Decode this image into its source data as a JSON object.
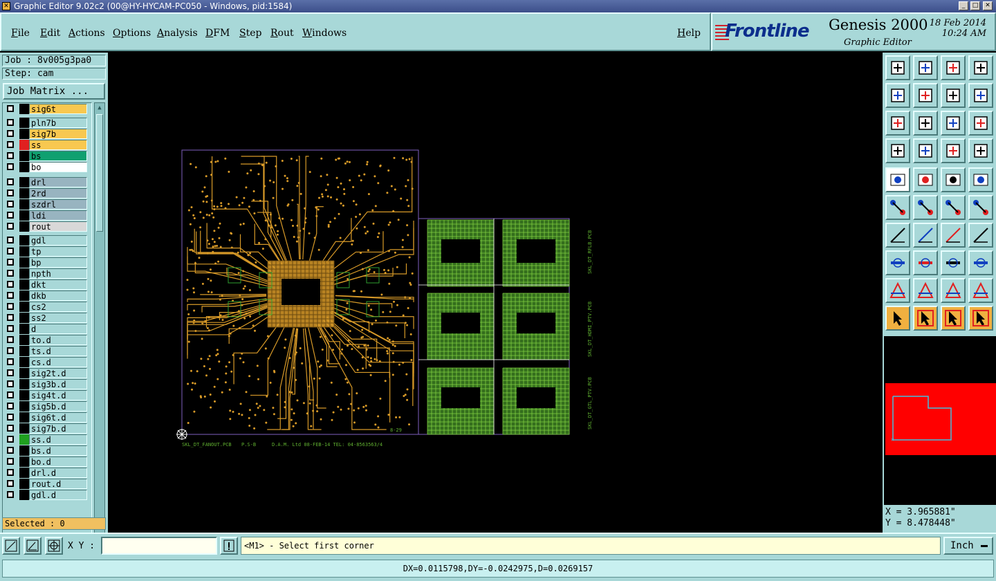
{
  "window": {
    "title": "Graphic Editor 9.02c2 (00@HY-HYCAM-PC050 - Windows, pid:1584)"
  },
  "menu": [
    "File",
    "Edit",
    "Actions",
    "Options",
    "Analysis",
    "DFM",
    "Step",
    "Rout",
    "Windows"
  ],
  "help_label": "Help",
  "brand": {
    "logo": "Frontline",
    "product": "Genesis 2000",
    "subtitle": "Graphic Editor",
    "date": "18 Feb 2014",
    "time": "10:24 AM"
  },
  "job": {
    "job_label": "Job : 8v005g3pa0",
    "step_label": "Step: cam",
    "matrix_button": "Job Matrix ..."
  },
  "layers": [
    {
      "name": "sig6t",
      "bg": "#f8c850",
      "swatch": "#000000"
    },
    {
      "name": "pln7b",
      "bg": "#a8d8d8",
      "swatch": "#000000"
    },
    {
      "name": "sig7b",
      "bg": "#f8c850",
      "swatch": "#000000"
    },
    {
      "name": "ss",
      "bg": "#f8c850",
      "swatch": "#e02020"
    },
    {
      "name": "bs",
      "bg": "#10a070",
      "swatch": "#000000"
    },
    {
      "name": "bo",
      "bg": "#ffffff",
      "swatch": "#000000"
    },
    {
      "name": "drl",
      "bg": "#98b4c0",
      "swatch": "#000000"
    },
    {
      "name": "2rd",
      "bg": "#98b4c0",
      "swatch": "#000000"
    },
    {
      "name": "szdrl",
      "bg": "#98b4c0",
      "swatch": "#000000"
    },
    {
      "name": "ldi",
      "bg": "#98b4c0",
      "swatch": "#000000"
    },
    {
      "name": "rout",
      "bg": "#d8d8d8",
      "swatch": "#000000"
    },
    {
      "name": "gdl",
      "bg": "#a8d8d8",
      "swatch": "#000000"
    },
    {
      "name": "tp",
      "bg": "#a8d8d8",
      "swatch": "#000000"
    },
    {
      "name": "bp",
      "bg": "#a8d8d8",
      "swatch": "#000000"
    },
    {
      "name": "npth",
      "bg": "#a8d8d8",
      "swatch": "#000000"
    },
    {
      "name": "dkt",
      "bg": "#a8d8d8",
      "swatch": "#000000"
    },
    {
      "name": "dkb",
      "bg": "#a8d8d8",
      "swatch": "#000000"
    },
    {
      "name": "cs2",
      "bg": "#a8d8d8",
      "swatch": "#000000"
    },
    {
      "name": "ss2",
      "bg": "#a8d8d8",
      "swatch": "#000000"
    },
    {
      "name": "d",
      "bg": "#a8d8d8",
      "swatch": "#000000"
    },
    {
      "name": "to.d",
      "bg": "#a8d8d8",
      "swatch": "#000000"
    },
    {
      "name": "ts.d",
      "bg": "#a8d8d8",
      "swatch": "#000000"
    },
    {
      "name": "cs.d",
      "bg": "#a8d8d8",
      "swatch": "#000000"
    },
    {
      "name": "sig2t.d",
      "bg": "#a8d8d8",
      "swatch": "#000000"
    },
    {
      "name": "sig3b.d",
      "bg": "#a8d8d8",
      "swatch": "#000000"
    },
    {
      "name": "sig4t.d",
      "bg": "#a8d8d8",
      "swatch": "#000000"
    },
    {
      "name": "sig5b.d",
      "bg": "#a8d8d8",
      "swatch": "#000000"
    },
    {
      "name": "sig6t.d",
      "bg": "#a8d8d8",
      "swatch": "#000000"
    },
    {
      "name": "sig7b.d",
      "bg": "#a8d8d8",
      "swatch": "#000000"
    },
    {
      "name": "ss.d",
      "bg": "#a8d8d8",
      "swatch": "#20a020"
    },
    {
      "name": "bs.d",
      "bg": "#a8d8d8",
      "swatch": "#000000"
    },
    {
      "name": "bo.d",
      "bg": "#a8d8d8",
      "swatch": "#000000"
    },
    {
      "name": "drl.d",
      "bg": "#a8d8d8",
      "swatch": "#000000"
    },
    {
      "name": "rout.d",
      "bg": "#a8d8d8",
      "swatch": "#000000"
    },
    {
      "name": "gdl.d",
      "bg": "#a8d8d8",
      "swatch": "#000000"
    }
  ],
  "selected_label": "Selected : 0",
  "board": {
    "main_label": "SKL_DT_FANOUT.PCB",
    "rev_label": "P.S-B",
    "info_label": "D.A.M. Ltd  08-FEB-14  TEL: 04-8563563/4",
    "corner_label": "8-29",
    "side_labels": [
      "SKL_DT_RFLB.PCB",
      "SKL_DT_HDMI_PTV.PCB",
      "SKL_DT_GTL_PTV.PCB"
    ]
  },
  "coords": {
    "x": "X = 3.965881\"",
    "y": "Y = 8.478448\""
  },
  "xy_label": "X Y :",
  "xy_value": "",
  "prompt": "<M1> - Select first corner",
  "units": "Inch",
  "status": "DX=0.0115798,DY=-0.0242975,D=0.0269157",
  "colors": {
    "panel": "#a8d8d8",
    "copper": "#d89a28",
    "green": "#60b030",
    "outline": "#8060c0",
    "overview_red": "#ff0000"
  }
}
